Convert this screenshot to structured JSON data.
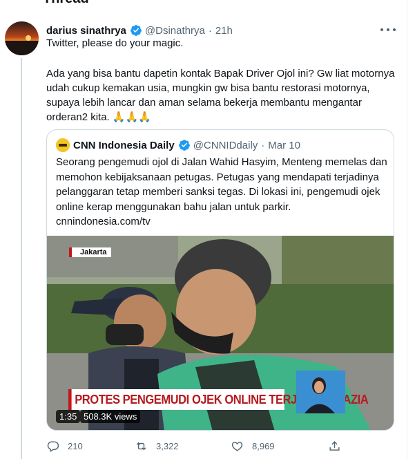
{
  "header": {
    "title": "Thread"
  },
  "tweet": {
    "author_name": "darius sinathrya",
    "handle": "@Dsinathrya",
    "time": "21h",
    "line1": "Twitter, please do your magic.",
    "body": "Ada yang bisa bantu dapetin kontak Bapak Driver Ojol ini? Gw liat motornya udah cukup kemakan usia, mungkin gw bisa bantu restorasi motornya, supaya lebih lancar dan aman selama bekerja membantu mengantar orderan2 kita. 🙏🙏🙏",
    "verified_color": "#1d9bf0"
  },
  "quote": {
    "author_name": "CNN Indonesia Daily",
    "handle": "@CNNIDdaily",
    "date": "Mar 10",
    "text": "Seorang pengemudi ojol di Jalan Wahid Hasyim, Menteng memelas dan memohon kebijaksanaan petugas. Petugas yang mendapati terjadinya pelanggaran tetap memberi sanksi tegas. Di lokasi ini, pengemudi ojek online kerap menggunakan bahu jalan untuk parkir.",
    "link": "cnnindonesia.com/tv",
    "video": {
      "location_tag": "Jakarta",
      "headline": "PROTES PENGEMUDI OJEK ONLINE TERJARING RAZIA",
      "duration": "1:35",
      "views": "508.3K views"
    }
  },
  "actions": {
    "replies": "210",
    "retweets": "3,322",
    "likes": "8,969"
  }
}
